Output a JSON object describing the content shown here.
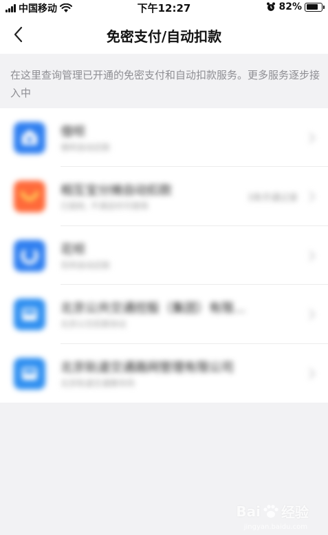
{
  "status_bar": {
    "carrier": "中国移动",
    "time": "下午12:27",
    "battery": "82%",
    "battery_level": 0.82
  },
  "nav": {
    "title": "免密支付/自动扣款"
  },
  "description": "在这里查询管理已开通的免密支付和自动扣款服务。更多服务逐步接入中",
  "items": [
    {
      "title": "借呗",
      "subtitle": "借呗自动还款",
      "right": "",
      "icon": "jiebei-icon",
      "color": "#2f7ff0"
    },
    {
      "title": "相互宝分摊自动扣款",
      "subtitle": "已授权, 不满足时可使用",
      "right": "3条开通记录",
      "icon": "xianghubao-icon",
      "color": "#ff6a3a"
    },
    {
      "title": "花呗",
      "subtitle": "花呗自动还款",
      "right": "",
      "icon": "huabei-icon",
      "color": "#2f7ff0"
    },
    {
      "title": "北京公共交通控股（集团）有限...",
      "subtitle": "北京公交扣款协议",
      "right": "",
      "icon": "bus-icon",
      "color": "#2f8ff0"
    },
    {
      "title": "北京轨道交通路网管理有限公司",
      "subtitle": "北京轨道交通乘车码",
      "right": "",
      "icon": "metro-icon",
      "color": "#2f8ff0"
    }
  ],
  "watermark": {
    "brand": "Bai",
    "brand_cn": "经验",
    "url": "jingyan.baidu.com"
  }
}
